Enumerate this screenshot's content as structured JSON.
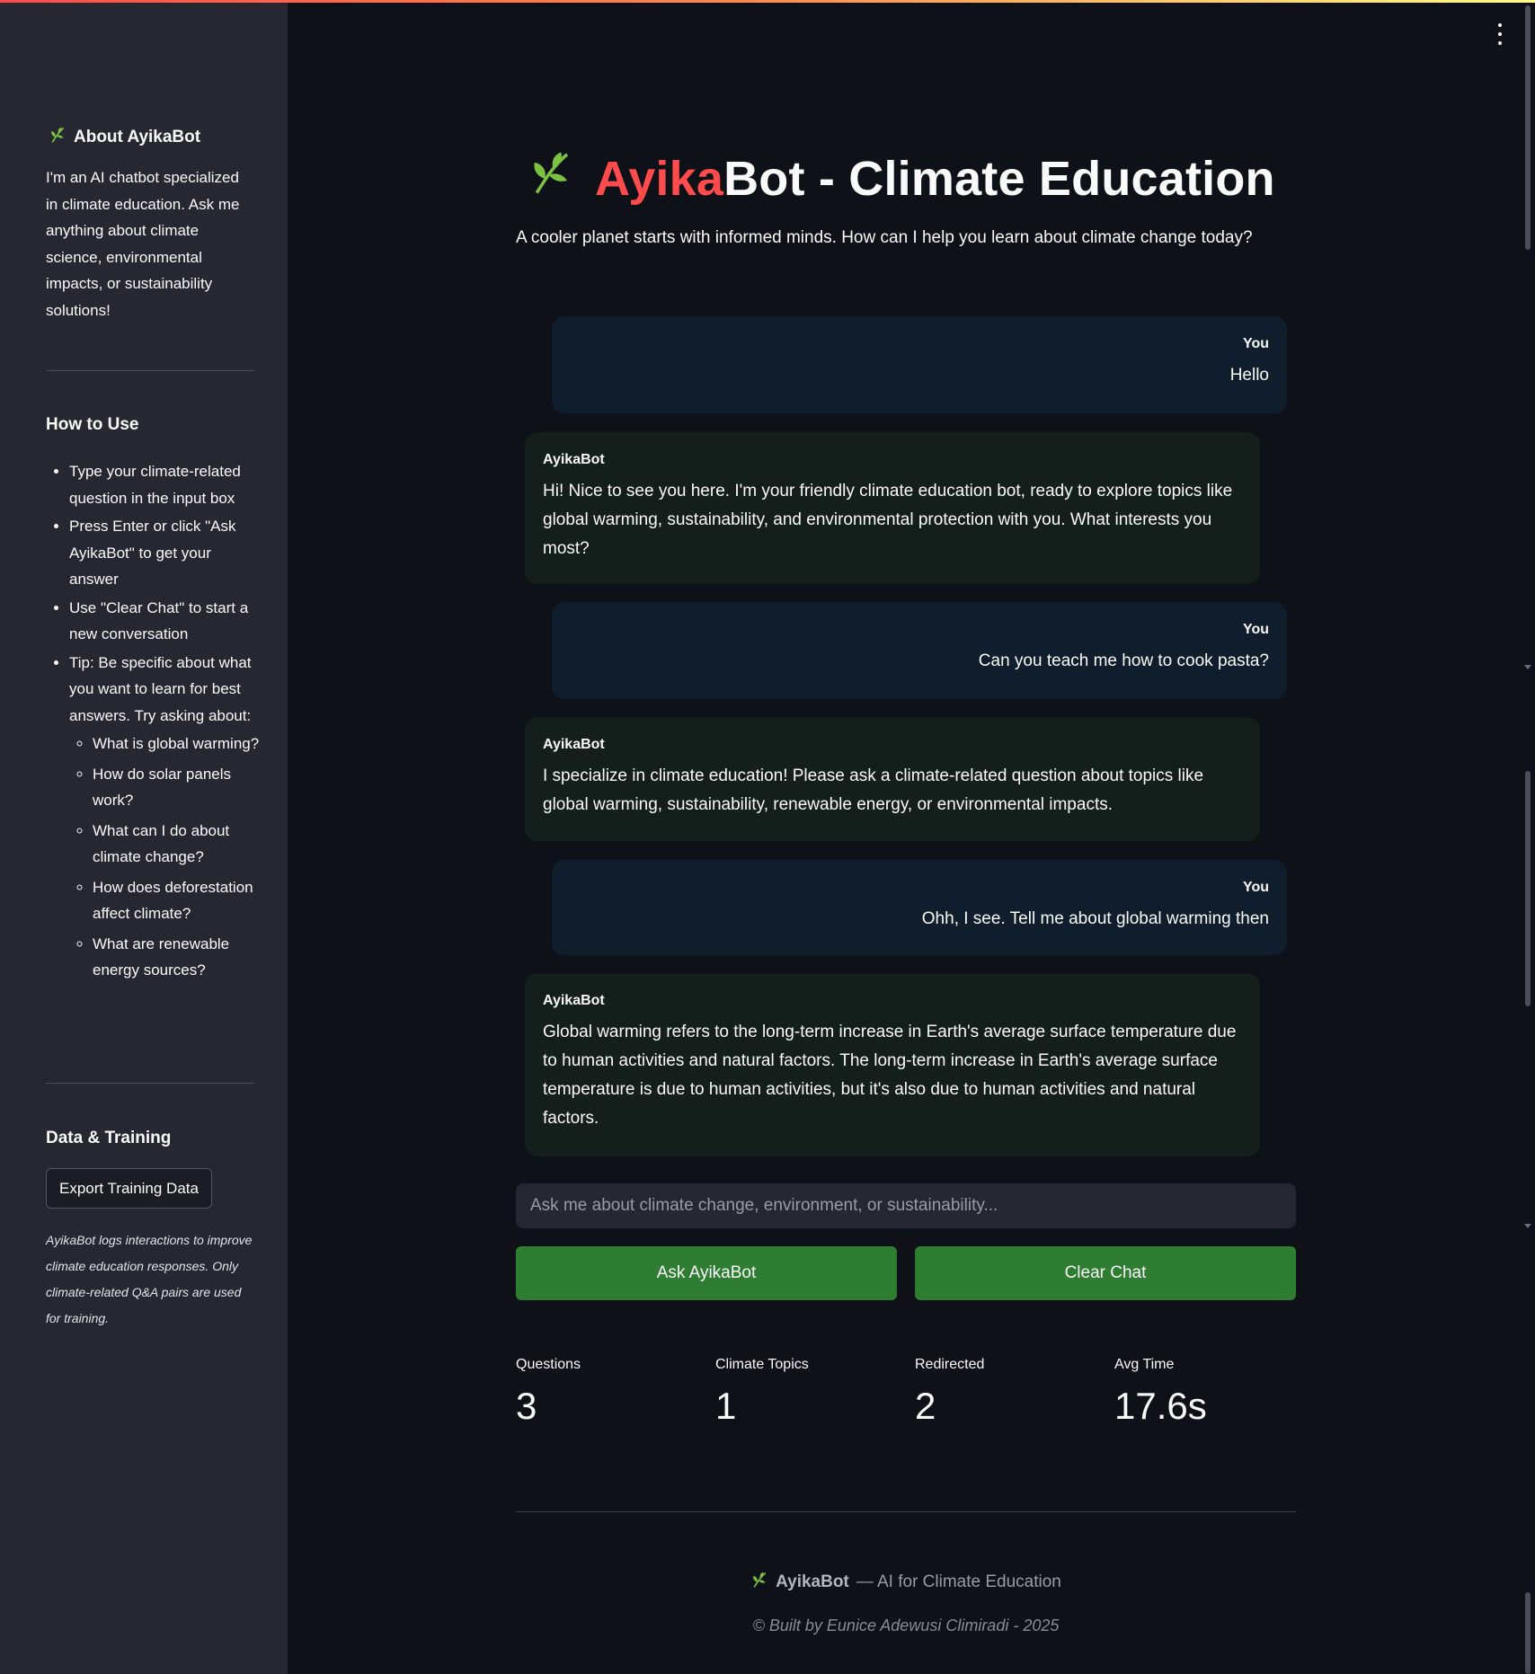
{
  "sidebar": {
    "about": {
      "title": "About AyikaBot",
      "icon": "leaf-icon",
      "text": "I'm an AI chatbot specialized in climate education. Ask me anything about climate science, environmental impacts, or sustainability solutions!"
    },
    "how_to_use": {
      "title": "How to Use",
      "items": [
        "Type your climate-related question in the input box",
        "Press Enter or click \"Ask AyikaBot\" to get your answer",
        "Use \"Clear Chat\" to start a new conversation",
        "Tip: Be specific about what you want to learn for best answers. Try asking about:"
      ],
      "examples": [
        "What is global warming?",
        "How do solar panels work?",
        "What can I do about climate change?",
        "How does deforestation affect climate?",
        "What are renewable energy sources?"
      ]
    },
    "data_training": {
      "title": "Data & Training",
      "export_label": "Export Training Data",
      "note": "AyikaBot logs interactions to improve climate education responses. Only climate-related Q&A pairs are used for training."
    }
  },
  "header": {
    "title_highlight": "Ayika",
    "title_rest": "Bot - Climate Education",
    "subtitle": "A cooler planet starts with informed minds. How can I help you learn about climate change today?",
    "icon": "leaf-icon"
  },
  "messages": [
    {
      "role": "user",
      "sender": "You",
      "text": "Hello"
    },
    {
      "role": "bot",
      "sender": "AyikaBot",
      "text": "Hi! Nice to see you here. I'm your friendly climate education bot, ready to explore topics like global warming, sustainability, and environmental protection with you. What interests you most?"
    },
    {
      "role": "user",
      "sender": "You",
      "text": "Can you teach me how to cook pasta?"
    },
    {
      "role": "bot",
      "sender": "AyikaBot",
      "text": "I specialize in climate education! Please ask a climate-related question about topics like global warming, sustainability, renewable energy, or environmental impacts."
    },
    {
      "role": "user",
      "sender": "You",
      "text": "Ohh, I see. Tell me about global warming then"
    },
    {
      "role": "bot",
      "sender": "AyikaBot",
      "text": "Global warming refers to the long-term increase in Earth's average surface temperature due to human activities and natural factors. The long-term increase in Earth's average surface temperature is due to human activities, but it's also due to human activities and natural factors."
    }
  ],
  "input": {
    "value": "",
    "placeholder": "Ask me about climate change, environment, or sustainability..."
  },
  "buttons": {
    "ask": "Ask AyikaBot",
    "clear": "Clear Chat"
  },
  "metrics": [
    {
      "label": "Questions",
      "value": "3"
    },
    {
      "label": "Climate Topics",
      "value": "1"
    },
    {
      "label": "Redirected",
      "value": "2"
    },
    {
      "label": "Avg Time",
      "value": "17.6s"
    }
  ],
  "footer": {
    "brand": "AyikaBot",
    "tagline": "— AI for Climate Education",
    "credit": "© Built by Eunice Adewusi Climiradi - 2025"
  },
  "colors": {
    "accent_red": "#ff4b4b",
    "button_green": "#2e7d32",
    "leaf_green": "#7cc242",
    "background": "#0e1117",
    "sidebar": "#262730"
  }
}
